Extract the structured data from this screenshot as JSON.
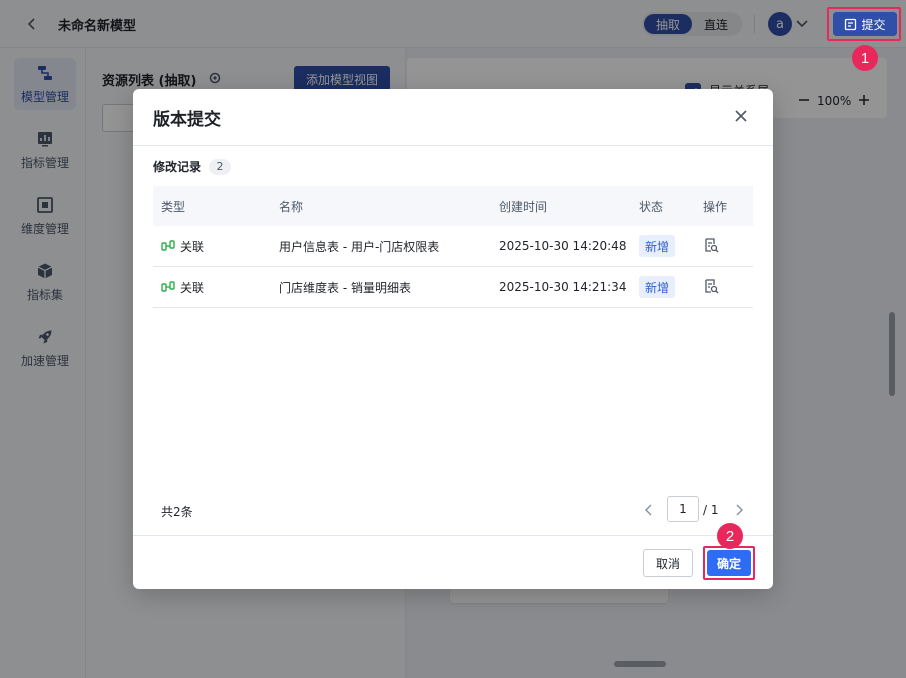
{
  "header": {
    "title": "未命名新模型",
    "mode_options": [
      "抽取",
      "直连"
    ],
    "active_mode": "抽取",
    "avatar_letter": "a",
    "submit_label": "提交"
  },
  "nav": {
    "items": [
      {
        "label": "模型管理",
        "icon": "model-icon",
        "active": true
      },
      {
        "label": "指标管理",
        "icon": "metric-icon",
        "active": false
      },
      {
        "label": "维度管理",
        "icon": "dimension-icon",
        "active": false
      },
      {
        "label": "指标集",
        "icon": "cube-icon",
        "active": false
      },
      {
        "label": "加速管理",
        "icon": "rocket-icon",
        "active": false
      }
    ]
  },
  "resources": {
    "title": "资源列表 (抽取)",
    "add_view_label": "添加模型视图"
  },
  "canvas": {
    "show_relation_label": "显示关系属",
    "zoom": "100%"
  },
  "annotations": {
    "step1": "1",
    "step2": "2"
  },
  "modal": {
    "title": "版本提交",
    "section_title": "修改记录",
    "record_count": "2",
    "columns": [
      "类型",
      "名称",
      "创建时间",
      "状态",
      "操作"
    ],
    "rows": [
      {
        "type": "关联",
        "name": "用户信息表 - 用户-门店权限表",
        "created": "2025-10-30 14:20:48",
        "status": "新增"
      },
      {
        "type": "关联",
        "name": "门店维度表 - 销量明细表",
        "created": "2025-10-30 14:21:34",
        "status": "新增"
      }
    ],
    "total_text": "共2条",
    "page_current": "1",
    "page_total": "/ 1",
    "cancel_label": "取消",
    "confirm_label": "确定"
  },
  "colors": {
    "primary": "#2f4fa8",
    "confirm": "#2f6cf6",
    "highlight": "#e8285a",
    "relation_icon": "#2bb04a"
  }
}
